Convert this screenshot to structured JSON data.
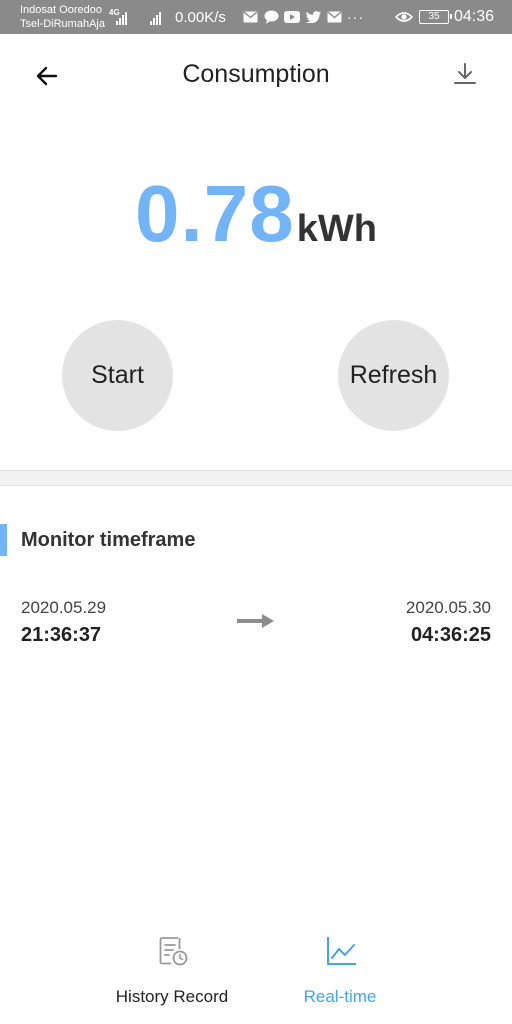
{
  "status_bar": {
    "carrier_1": "Indosat Ooredoo",
    "carrier_2": "Tsel-DiRumahAja",
    "network_tag": "4G",
    "speed": "0.00K/s",
    "more": "···",
    "battery": "35",
    "time": "04:36"
  },
  "header": {
    "title": "Consumption",
    "back_icon": "arrow-left-icon",
    "download_icon": "download-icon"
  },
  "consumption": {
    "value": "0.78",
    "unit": "kWh"
  },
  "actions": {
    "start_label": "Start",
    "refresh_label": "Refresh"
  },
  "monitor": {
    "title": "Monitor timeframe",
    "start_date": "2020.05.29",
    "start_time": "21:36:37",
    "end_date": "2020.05.30",
    "end_time": "04:36:25"
  },
  "bottom_nav": {
    "items": [
      {
        "label": "History Record",
        "icon": "history-record-icon",
        "active": false
      },
      {
        "label": "Real-time",
        "icon": "realtime-chart-icon",
        "active": true
      }
    ]
  },
  "colors": {
    "accent": "#72b4f5",
    "active_tab": "#3fa6e8",
    "status_bar": "#8a8a8a",
    "button_bg": "#e3e3e3"
  }
}
